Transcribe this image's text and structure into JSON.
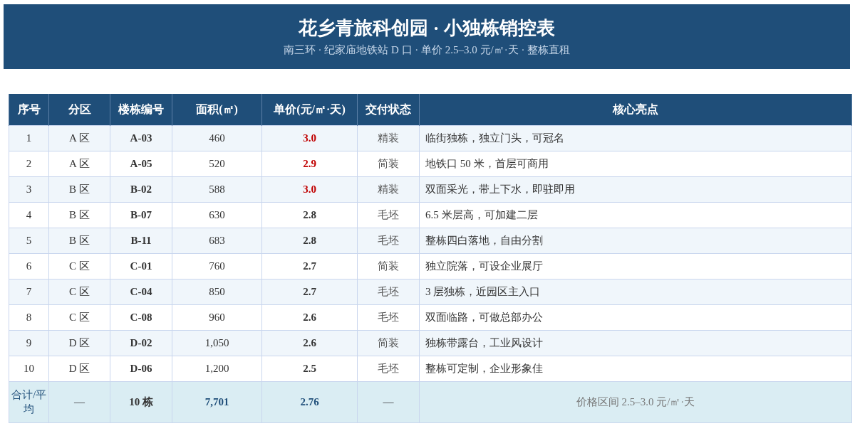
{
  "header": {
    "title": "花乡青旅科创园 · 小独栋销控表",
    "subtitle": "南三环 · 纪家庙地铁站 D 口 · 单价 2.5–3.0 元/㎡·天 · 整栋直租"
  },
  "table": {
    "columns": [
      "序号",
      "分区",
      "楼栋编号",
      "面积(㎡)",
      "单价(元/㎡·天)",
      "交付状态",
      "核心亮点"
    ],
    "rows": [
      {
        "no": "1",
        "zone": "A 区",
        "building": "A-03",
        "area": "460",
        "price": "3.0",
        "price_highlight": true,
        "status": "精装",
        "highlight": "临街独栋，独立门头，可冠名"
      },
      {
        "no": "2",
        "zone": "A 区",
        "building": "A-05",
        "area": "520",
        "price": "2.9",
        "price_highlight": true,
        "status": "简装",
        "highlight": "地铁口 50 米，首层可商用"
      },
      {
        "no": "3",
        "zone": "B 区",
        "building": "B-02",
        "area": "588",
        "price": "3.0",
        "price_highlight": true,
        "status": "精装",
        "highlight": "双面采光，带上下水，即驻即用"
      },
      {
        "no": "4",
        "zone": "B 区",
        "building": "B-07",
        "area": "630",
        "price": "2.8",
        "price_highlight": false,
        "status": "毛坯",
        "highlight": "6.5 米层高，可加建二层"
      },
      {
        "no": "5",
        "zone": "B 区",
        "building": "B-11",
        "area": "683",
        "price": "2.8",
        "price_highlight": false,
        "status": "毛坯",
        "highlight": "整栋四白落地，自由分割"
      },
      {
        "no": "6",
        "zone": "C 区",
        "building": "C-01",
        "area": "760",
        "price": "2.7",
        "price_highlight": false,
        "status": "简装",
        "highlight": "独立院落，可设企业展厅"
      },
      {
        "no": "7",
        "zone": "C 区",
        "building": "C-04",
        "area": "850",
        "price": "2.7",
        "price_highlight": false,
        "status": "毛坯",
        "highlight": "3 层独栋，近园区主入口"
      },
      {
        "no": "8",
        "zone": "C 区",
        "building": "C-08",
        "area": "960",
        "price": "2.6",
        "price_highlight": false,
        "status": "毛坯",
        "highlight": "双面临路，可做总部办公"
      },
      {
        "no": "9",
        "zone": "D 区",
        "building": "D-02",
        "area": "1,050",
        "price": "2.6",
        "price_highlight": false,
        "status": "简装",
        "highlight": "独栋带露台，工业风设计"
      },
      {
        "no": "10",
        "zone": "D 区",
        "building": "D-06",
        "area": "1,200",
        "price": "2.5",
        "price_highlight": false,
        "status": "毛坯",
        "highlight": "整栋可定制，企业形象佳"
      }
    ],
    "total": {
      "no": "合计/平均",
      "zone": "—",
      "building": "10 栋",
      "area": "7,701",
      "price": "2.76",
      "status": "—",
      "highlight": "价格区间 2.5–3.0 元/㎡·天"
    }
  }
}
